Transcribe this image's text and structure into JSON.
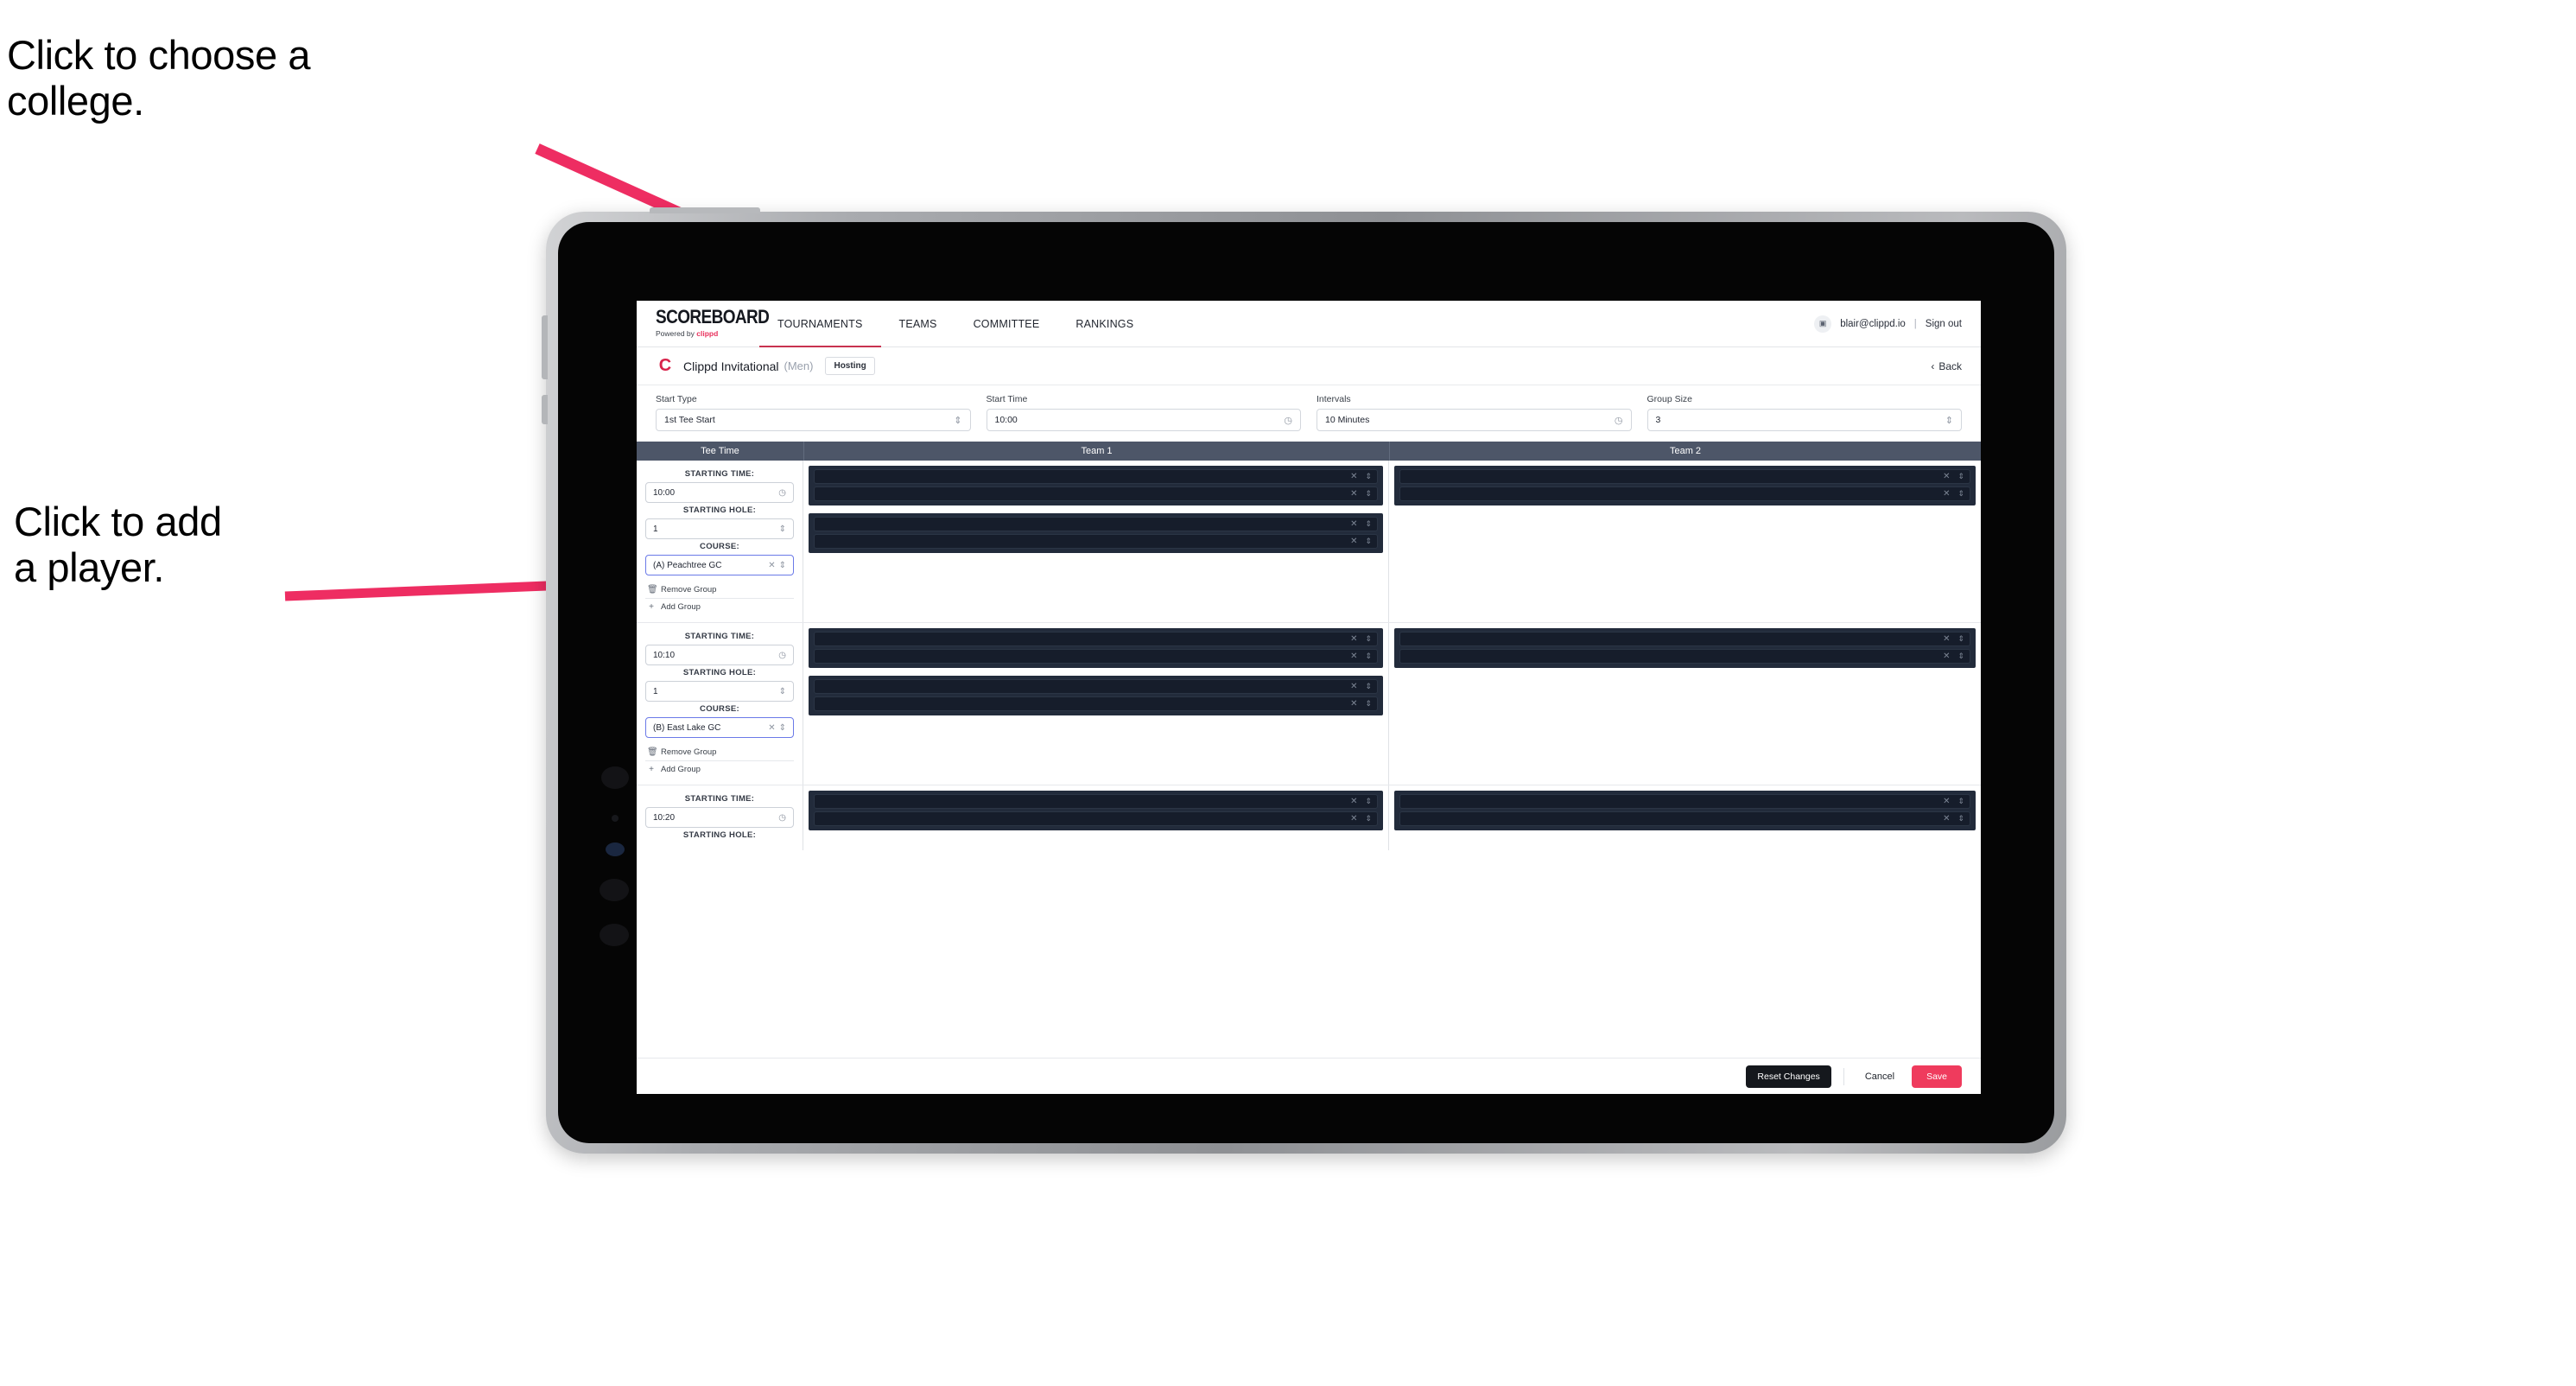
{
  "annotations": [
    {
      "id": "choose-college",
      "text": "Click to choose a\ncollege."
    },
    {
      "id": "add-player",
      "text": "Click to add\na player."
    }
  ],
  "colors": {
    "accent": "#ef3b5d",
    "brand_red": "#d8224a",
    "tab_underline": "#c8324f",
    "table_header_bg": "#4d5668",
    "player_group_bg": "#222b3b",
    "player_row_bg": "#161d2b"
  },
  "app": {
    "logo": {
      "word": "SCOREBOARD",
      "sub_prefix": "Powered by ",
      "sub_brand": "clippd"
    },
    "nav_tabs": [
      {
        "label": "TOURNAMENTS",
        "active": true
      },
      {
        "label": "TEAMS",
        "active": false
      },
      {
        "label": "COMMITTEE",
        "active": false
      },
      {
        "label": "RANKINGS",
        "active": false
      }
    ],
    "user": {
      "avatar_glyph": "▣",
      "email": "blair@clippd.io",
      "separator": "|",
      "sign_out": "Sign out"
    },
    "event": {
      "logo_letter": "C",
      "title": "Clippd Invitational",
      "gender": "(Men)",
      "badge": "Hosting",
      "back_label": "Back",
      "back_chevron": "‹"
    },
    "controls": [
      {
        "label": "Start Type",
        "value": "1st Tee Start",
        "icon": "chevron-updown"
      },
      {
        "label": "Start Time",
        "value": "10:00",
        "icon": "clock"
      },
      {
        "label": "Intervals",
        "value": "10 Minutes",
        "icon": "clock"
      },
      {
        "label": "Group Size",
        "value": "3",
        "icon": "chevron-updown"
      }
    ],
    "table": {
      "columns": [
        "Tee Time",
        "Team 1",
        "Team 2"
      ],
      "field_labels": {
        "starting_time": "STARTING TIME:",
        "starting_hole": "STARTING HOLE:",
        "course": "COURSE:"
      },
      "group_actions": {
        "remove": "Remove Group",
        "add": "Add Group"
      },
      "groups": [
        {
          "starting_time": "10:00",
          "starting_hole": "1",
          "course": "(A) Peachtree GC",
          "team1": [
            {
              "players": [
                "",
                ""
              ]
            },
            {
              "players": [
                "",
                ""
              ]
            }
          ],
          "team2": [
            {
              "players": [
                "",
                ""
              ]
            }
          ]
        },
        {
          "starting_time": "10:10",
          "starting_hole": "1",
          "course": "(B) East Lake GC",
          "team1": [
            {
              "players": [
                "",
                ""
              ]
            },
            {
              "players": [
                "",
                ""
              ]
            }
          ],
          "team2": [
            {
              "players": [
                "",
                ""
              ]
            }
          ]
        },
        {
          "starting_time": "10:20",
          "starting_hole": "",
          "course": "",
          "team1": [
            {
              "players": [
                "",
                ""
              ]
            }
          ],
          "team2": [
            {
              "players": [
                "",
                ""
              ]
            }
          ]
        }
      ]
    },
    "footer": {
      "reset": "Reset Changes",
      "cancel": "Cancel",
      "save": "Save"
    }
  }
}
